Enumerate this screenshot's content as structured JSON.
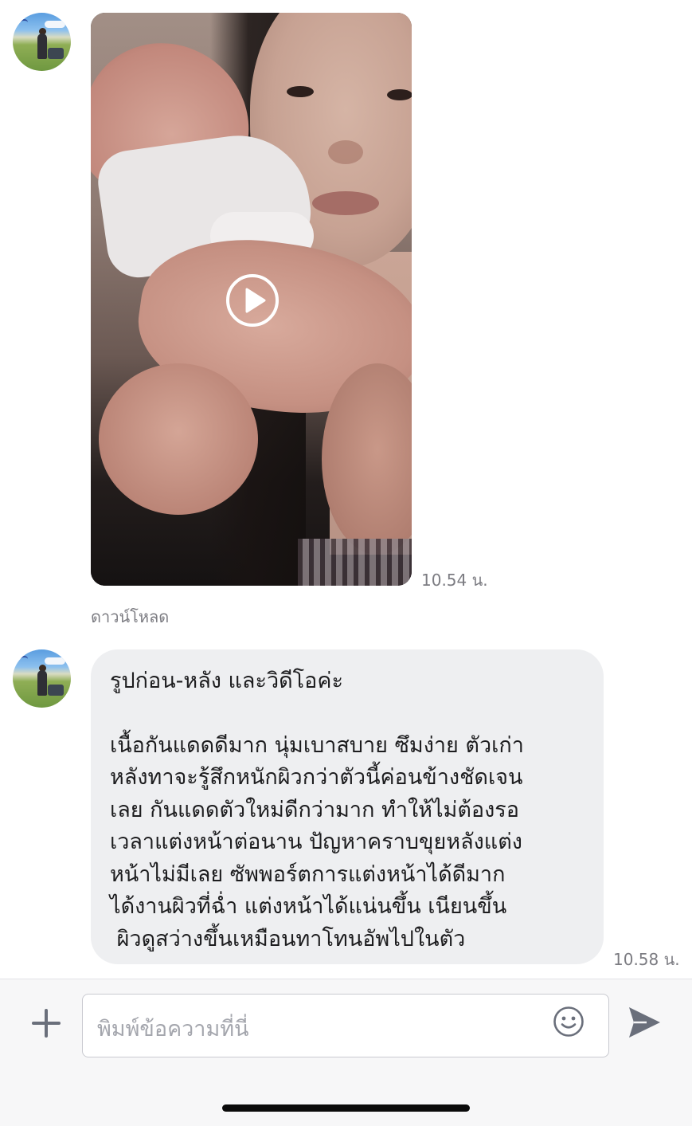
{
  "messages": [
    {
      "type": "video",
      "time": "10.54 น.",
      "download_label": "ดาวน์โหลด"
    },
    {
      "type": "text",
      "time": "10.58 น.",
      "lines": [
        "รูปก่อน-หลัง และวิดีโอค่ะ",
        "",
        "เนื้อกันแดดดีมาก นุ่มเบาสบาย ซึมง่าย ตัวเก่า",
        "หลังทาจะรู้สึกหนักผิวกว่าตัวนี้ค่อนข้างชัดเจน",
        "เลย กันแดดตัวใหม่ดีกว่ามาก ทำให้ไม่ต้องรอ",
        "เวลาแต่งหน้าต่อนาน ปัญหาคราบขุยหลังแต่ง",
        "หน้าไม่มีเลย ซัพพอร์ตการแต่งหน้าได้ดีมาก",
        "ได้งานผิวที่ฉ่ำ แต่งหน้าได้แน่นขึ้น เนียนขึ้น",
        " ผิวดูสว่างขึ้นเหมือนทาโทนอัพไปในตัว"
      ]
    }
  ],
  "input_bar": {
    "placeholder": "พิมพ์ข้อความที่นี่",
    "value": ""
  },
  "icons": {
    "add": "plus-icon",
    "emoji": "smiley-icon",
    "send": "send-icon",
    "play": "play-icon"
  },
  "colors": {
    "bubble_bg": "#eeeff1",
    "icon_gray": "#6a6f7b",
    "timestamp_gray": "#7c7c82"
  }
}
